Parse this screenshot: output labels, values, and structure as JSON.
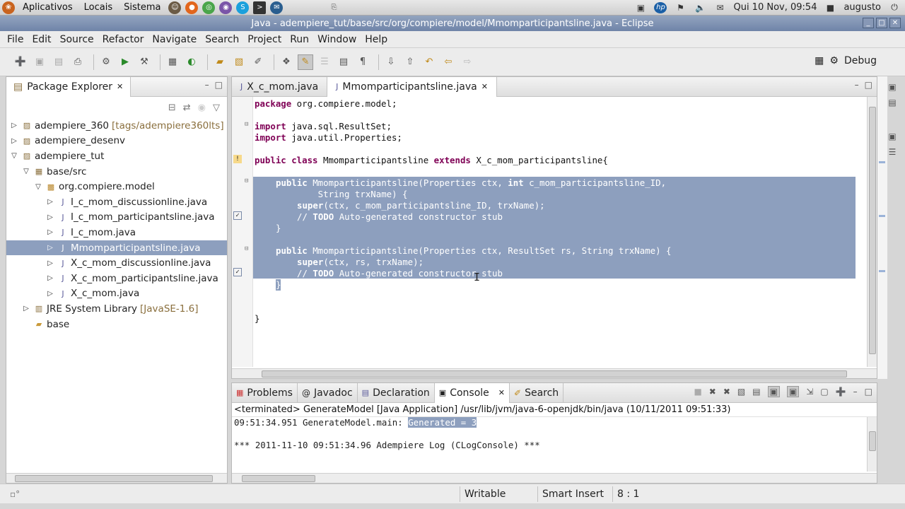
{
  "gnome_panel": {
    "menus": [
      "Aplicativos",
      "Locais",
      "Sistema"
    ],
    "clock": "Qui 10 Nov, 09:54",
    "user": "augusto"
  },
  "window": {
    "title": "Java - adempiere_tut/base/src/org/compiere/model/Mmomparticipantsline.java - Eclipse"
  },
  "menubar": [
    "File",
    "Edit",
    "Source",
    "Refactor",
    "Navigate",
    "Search",
    "Project",
    "Run",
    "Window",
    "Help"
  ],
  "perspective": {
    "label": "Debug"
  },
  "package_explorer": {
    "title": "Package Explorer",
    "items": [
      {
        "label": "adempiere_360",
        "suffix": "[tags/adempiere360lts]",
        "depth": 0,
        "twisty": "closed",
        "icon": "project-icon"
      },
      {
        "label": "adempiere_desenv",
        "suffix": "",
        "depth": 0,
        "twisty": "closed",
        "icon": "project-icon"
      },
      {
        "label": "adempiere_tut",
        "suffix": "",
        "depth": 0,
        "twisty": "open",
        "icon": "project-icon"
      },
      {
        "label": "base/src",
        "suffix": "",
        "depth": 1,
        "twisty": "open",
        "icon": "source-folder-icon"
      },
      {
        "label": "org.compiere.model",
        "suffix": "",
        "depth": 2,
        "twisty": "open",
        "icon": "package-icon"
      },
      {
        "label": "I_c_mom_discussionline.java",
        "suffix": "",
        "depth": 3,
        "twisty": "closed",
        "icon": "java-file-icon"
      },
      {
        "label": "I_c_mom_participantsline.java",
        "suffix": "",
        "depth": 3,
        "twisty": "closed",
        "icon": "java-file-icon"
      },
      {
        "label": "I_c_mom.java",
        "suffix": "",
        "depth": 3,
        "twisty": "closed",
        "icon": "java-file-icon"
      },
      {
        "label": "Mmomparticipantsline.java",
        "suffix": "",
        "depth": 3,
        "twisty": "closed",
        "icon": "java-file-icon",
        "selected": true
      },
      {
        "label": "X_c_mom_discussionline.java",
        "suffix": "",
        "depth": 3,
        "twisty": "closed",
        "icon": "java-file-icon"
      },
      {
        "label": "X_c_mom_participantsline.java",
        "suffix": "",
        "depth": 3,
        "twisty": "closed",
        "icon": "java-file-icon"
      },
      {
        "label": "X_c_mom.java",
        "suffix": "",
        "depth": 3,
        "twisty": "closed",
        "icon": "java-file-icon"
      },
      {
        "label": "JRE System Library",
        "suffix": "[JavaSE-1.6]",
        "depth": 1,
        "twisty": "closed",
        "icon": "library-icon"
      },
      {
        "label": "base",
        "suffix": "",
        "depth": 1,
        "twisty": "none",
        "icon": "folder-icon"
      }
    ]
  },
  "editor": {
    "tabs": [
      {
        "label": "X_c_mom.java",
        "active": false
      },
      {
        "label": "Mmomparticipantsline.java",
        "active": true
      }
    ],
    "code": {
      "package_kw": "package",
      "package_rest": " org.compiere.model;",
      "import_kw": "import",
      "import1_rest": " java.sql.ResultSet;",
      "import2_rest": " java.util.Properties;",
      "class_kw1": "public class",
      "class_name": " Mmomparticipantsline ",
      "class_kw2": "extends",
      "class_rest": " X_c_mom_participantsline{",
      "ctor1_line1_kw": "public",
      "ctor1_line1_a": " Mmomparticipantsline(Properties ctx, ",
      "ctor1_line1_kw2": "int",
      "ctor1_line1_b": " c_mom_participantsline_ID,",
      "ctor1_line2": "        String trxName) {",
      "super_kw": "super",
      "ctor1_super_rest": "(ctx, c_mom_participantsline_ID, trxName);",
      "todo_a": "// ",
      "todo_kw": "TODO",
      "todo_b": " Auto-generated constructor stub",
      "close_brace": "}",
      "ctor2_line1_kw": "public",
      "ctor2_line1_rest": " Mmomparticipantsline(Properties ctx, ResultSet rs, String trxName) {",
      "ctor2_super_rest": "(ctx, rs, trxName);",
      "class_close": "}"
    }
  },
  "console": {
    "tabs": [
      {
        "label": "Problems",
        "icon": "problems-icon"
      },
      {
        "label": "Javadoc",
        "icon": "javadoc-icon"
      },
      {
        "label": "Declaration",
        "icon": "declaration-icon"
      },
      {
        "label": "Console",
        "icon": "console-icon",
        "active": true
      },
      {
        "label": "Search",
        "icon": "search-icon"
      }
    ],
    "header": "<terminated> GenerateModel [Java Application] /usr/lib/jvm/java-6-openjdk/bin/java (10/11/2011 09:51:33)",
    "line1_prefix": "09:51:34.951 GenerateModel.main: ",
    "line1_highlight": "Generated = 3",
    "line2": "*** 2011-11-10 09:51:34.96 Adempiere Log (CLogConsole) ***"
  },
  "statusbar": {
    "writable": "Writable",
    "insert_mode": "Smart Insert",
    "position": "8 : 1"
  },
  "colors": {
    "selection": "#8d9fbe",
    "keyword": "#7f0055",
    "comment": "#3f7f5f",
    "titlebar": "#7f93b4"
  }
}
